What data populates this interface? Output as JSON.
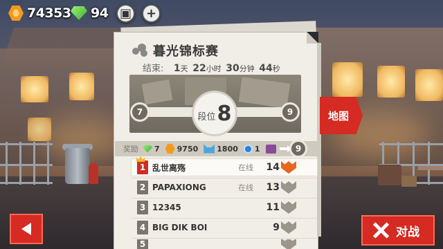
{
  "hud": {
    "coins": "74353",
    "gems": "94"
  },
  "panel": {
    "title": "暮光锦标赛",
    "timer_label": "结束:",
    "timer": {
      "days": "1",
      "days_unit": "天",
      "hours": "22",
      "hours_unit": "小时",
      "minutes": "30",
      "minutes_unit": "分钟",
      "seconds": "44",
      "seconds_unit": "秒"
    },
    "progress": {
      "prev_rank": "7",
      "rank_label": "段位",
      "rank": "8",
      "next_rank": "9"
    }
  },
  "rewards": {
    "label": "奖励",
    "gems": "7",
    "coins": "9750",
    "cats": "1800",
    "paws": "1",
    "next_rank": "9"
  },
  "leaderboard": [
    {
      "rank": "1",
      "name": "乱世离殇",
      "status": "在线",
      "score": "14",
      "medal_color": "#e9661f",
      "rank_color": "#cf2c24"
    },
    {
      "rank": "2",
      "name": "PAPAXIONG",
      "status": "在线",
      "score": "13",
      "medal_color": "#9b958a",
      "rank_color": "#7b766c"
    },
    {
      "rank": "3",
      "name": "12345",
      "status": "",
      "score": "11",
      "medal_color": "#9b958a",
      "rank_color": "#7b766c"
    },
    {
      "rank": "4",
      "name": "BIG DIK BOI",
      "status": "",
      "score": "9",
      "medal_color": "#9b958a",
      "rank_color": "#7b766c"
    },
    {
      "rank": "5",
      "name": "",
      "status": "",
      "score": "",
      "medal_color": "#9b958a",
      "rank_color": "#7b766c"
    }
  ],
  "buttons": {
    "map": "地图",
    "fight": "对战"
  },
  "colors": {
    "accent_red": "#d52b22",
    "coin_orange": "#f39a1d",
    "gem_green": "#5ad13a"
  }
}
